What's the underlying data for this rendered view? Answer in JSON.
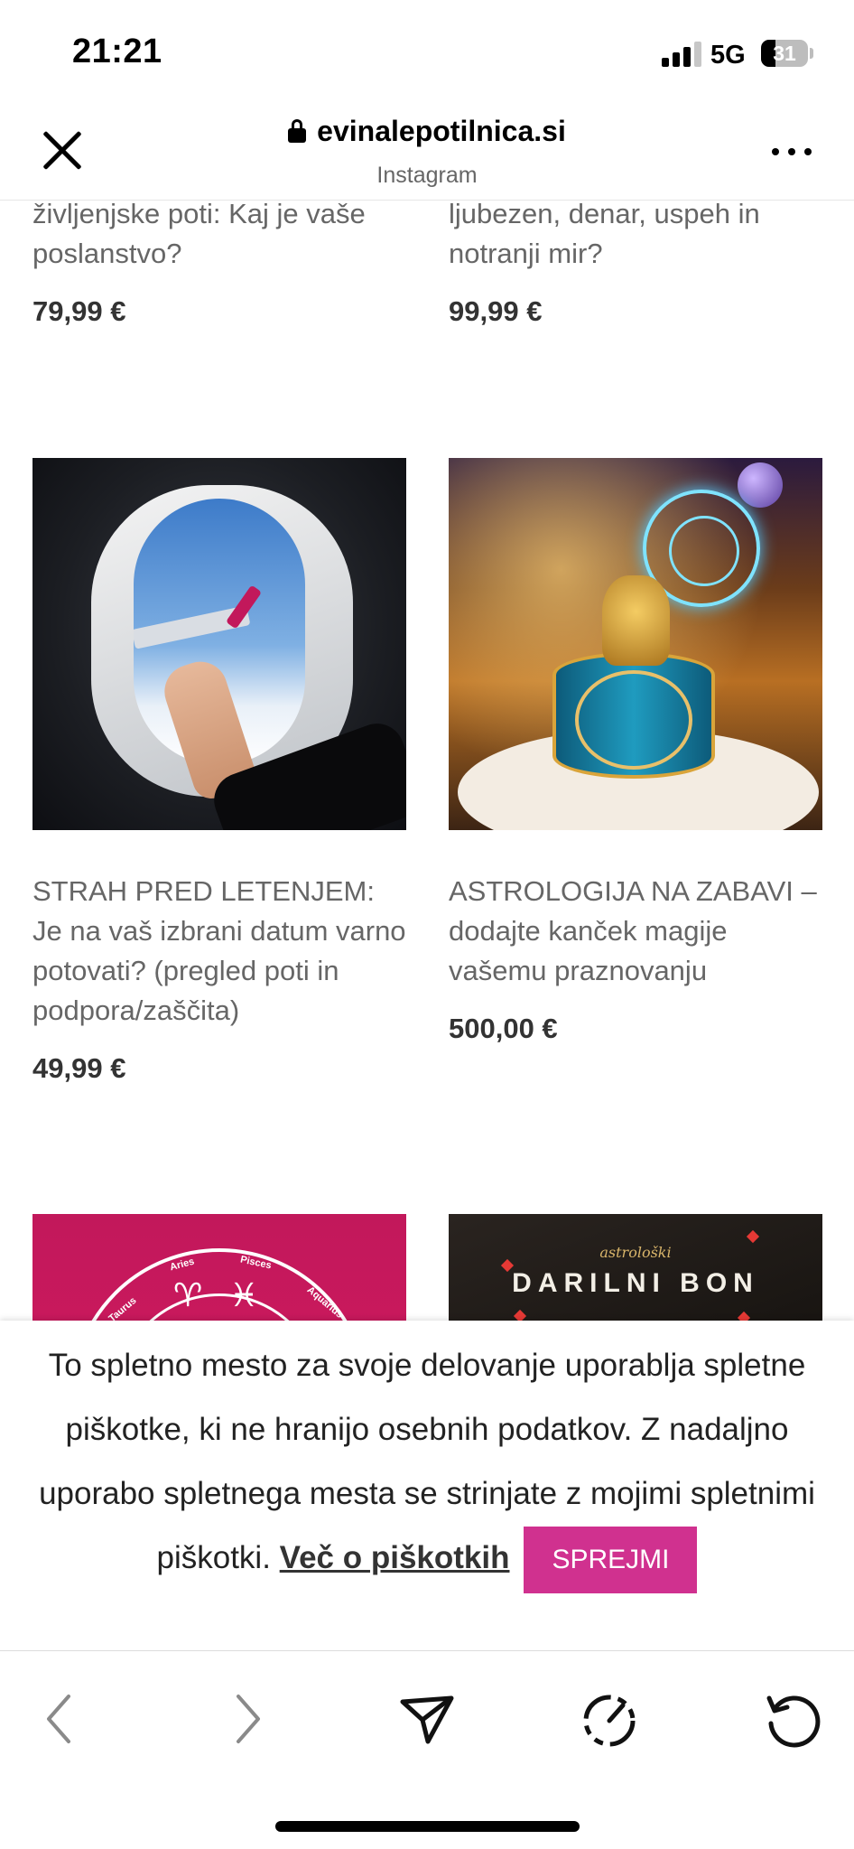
{
  "status_bar": {
    "time": "21:21",
    "network": "5G",
    "battery": "31"
  },
  "browser": {
    "domain": "evinalepotilnica.si",
    "subtitle": "Instagram",
    "icons": [
      "close-icon",
      "lock-icon",
      "more-icon"
    ]
  },
  "products": [
    {
      "title": "življenjske poti: Kaj je vaše poslanstvo?",
      "price": "79,99 €"
    },
    {
      "title": "ljubezen, denar, uspeh in notranji mir?",
      "price": "99,99 €"
    },
    {
      "title": "STRAH PRED LETENJEM: Je na vaš izbrani datum varno potovati? (pregled poti in podpora/zaščita)",
      "price": "49,99 €"
    },
    {
      "title": "ASTROLOGIJA NA ZABAVI – dodajte kanček magije vašemu praznovanju",
      "price": "500,00 €"
    }
  ],
  "images": {
    "pink_wheel": {
      "labels": [
        "Taurus",
        "Aries",
        "Pisces",
        "Aquarius"
      ],
      "symbols": [
        "♉",
        "♈",
        "♓",
        "♒"
      ]
    },
    "voucher": {
      "small": "astrološki",
      "big": "DARILNI BON"
    }
  },
  "cookie_banner": {
    "text": "To spletno mesto za svoje delovanje uporablja spletne piškotke, ki ne hranijo osebnih podatkov. Z nadaljno uporabo spletnega mesta se strinjate z mojimi spletnimi piškotki.",
    "link": "Več o piškotkih",
    "button": "SPREJMI",
    "button_color": "#d0318f"
  },
  "toolbar": {
    "icons": [
      "back-icon",
      "forward-icon",
      "share-icon",
      "speed-icon",
      "reload-icon"
    ]
  }
}
